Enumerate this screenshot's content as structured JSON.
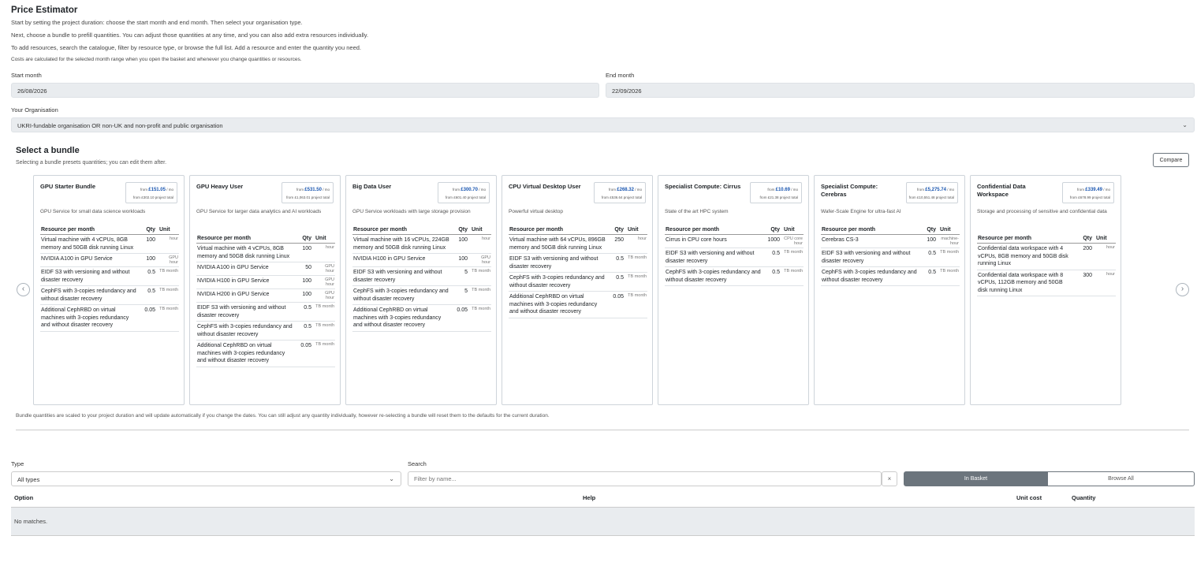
{
  "page": {
    "title": "Price Estimator",
    "intro": [
      "Start by setting the project duration: choose the start month and end month. Then select your organisation type.",
      "Next, choose a bundle to prefill quantities. You can adjust those quantities at any time, and you can also add extra resources individually.",
      "To add resources, search the catalogue, filter by resource type, or browse the full list. Add a resource and enter the quantity you need.",
      "Costs are calculated for the selected month range when you open the basket and whenever you change quantities or resources."
    ]
  },
  "dates": {
    "start_label": "Start month",
    "start_value": "26/08/2026",
    "end_label": "End month",
    "end_value": "22/09/2026"
  },
  "org": {
    "label": "Your Organisation",
    "value": "UKRI-fundable organisation OR non-UK and non-profit and public organisation"
  },
  "bundles": {
    "title": "Select a bundle",
    "subtitle": "Selecting a bundle presets quantities; you can edit them after.",
    "compare_label": "Compare",
    "prev_icon": "chevron-left-icon",
    "next_icon": "chevron-right-icon",
    "note": "Bundle quantities are scaled to your project duration and will update automatically if you change the dates. You can still adjust any quantity individually, however re-selecting a bundle will reset them to the defaults for the current duration.",
    "headers": {
      "resource": "Resource per month",
      "qty": "Qty",
      "unit": "Unit"
    },
    "price_from": "from",
    "per_month": "/ mo",
    "project_total": "project total",
    "cards": [
      {
        "name": "GPU Starter Bundle",
        "monthly": "£151.05",
        "total": "£302.10",
        "desc": "GPU Service for small data science workloads",
        "rows": [
          {
            "r": "Virtual machine with 4 vCPUs, 8GB memory and 50GB disk running Linux",
            "q": "100",
            "u": "hour"
          },
          {
            "r": "NVIDIA A100 in GPU Service",
            "q": "100",
            "u": "GPU hour"
          },
          {
            "r": "EIDF S3 with versioning and without disaster recovery",
            "q": "0.5",
            "u": "TB month"
          },
          {
            "r": "CephFS with 3-copies redundancy and without disaster recovery",
            "q": "0.5",
            "u": "TB month"
          },
          {
            "r": "Additional CephRBD on virtual machines with 3-copies redundancy and without disaster recovery",
            "q": "0.05",
            "u": "TB month"
          }
        ]
      },
      {
        "name": "GPU Heavy User",
        "monthly": "£531.50",
        "total": "£1,063.01",
        "desc": "GPU Service for larger data analytics and AI workloads",
        "rows": [
          {
            "r": "Virtual machine with 4 vCPUs, 8GB memory and 50GB disk running Linux",
            "q": "100",
            "u": "hour"
          },
          {
            "r": "NVIDIA A100 in GPU Service",
            "q": "50",
            "u": "GPU hour"
          },
          {
            "r": "NVIDIA H100 in GPU Service",
            "q": "100",
            "u": "GPU hour"
          },
          {
            "r": "NVIDIA H200 in GPU Service",
            "q": "100",
            "u": "GPU hour"
          },
          {
            "r": "EIDF S3 with versioning and without disaster recovery",
            "q": "0.5",
            "u": "TB month"
          },
          {
            "r": "CephFS with 3-copies redundancy and without disaster recovery",
            "q": "0.5",
            "u": "TB month"
          },
          {
            "r": "Additional CephRBD on virtual machines with 3-copies redundancy and without disaster recovery",
            "q": "0.05",
            "u": "TB month"
          }
        ]
      },
      {
        "name": "Big Data User",
        "monthly": "£300.70",
        "total": "£601.40",
        "desc": "GPU Service workloads with large storage provision",
        "rows": [
          {
            "r": "Virtual machine with 16 vCPUs, 224GB memory and 50GB disk running Linux",
            "q": "100",
            "u": "hour"
          },
          {
            "r": "NVIDIA H100 in GPU Service",
            "q": "100",
            "u": "GPU hour"
          },
          {
            "r": "EIDF S3 with versioning and without disaster recovery",
            "q": "5",
            "u": "TB month"
          },
          {
            "r": "CephFS with 3-copies redundancy and without disaster recovery",
            "q": "5",
            "u": "TB month"
          },
          {
            "r": "Additional CephRBD on virtual machines with 3-copies redundancy and without disaster recovery",
            "q": "0.05",
            "u": "TB month"
          }
        ]
      },
      {
        "name": "CPU Virtual Desktop User",
        "monthly": "£268.32",
        "total": "£536.64",
        "desc": "Powerful virtual desktop",
        "rows": [
          {
            "r": "Virtual machine with 64 vCPUs, 896GB memory and 50GB disk running Linux",
            "q": "250",
            "u": "hour"
          },
          {
            "r": "EIDF S3 with versioning and without disaster recovery",
            "q": "0.5",
            "u": "TB month"
          },
          {
            "r": "CephFS with 3-copies redundancy and without disaster recovery",
            "q": "0.5",
            "u": "TB month"
          },
          {
            "r": "Additional CephRBD on virtual machines with 3-copies redundancy and without disaster recovery",
            "q": "0.05",
            "u": "TB month"
          }
        ]
      },
      {
        "name": "Specialist Compute: Cirrus",
        "monthly": "£10.69",
        "total": "£21.38",
        "desc": "State of the art HPC system",
        "rows": [
          {
            "r": "Cirrus in CPU core hours",
            "q": "1000",
            "u": "CPU core hour"
          },
          {
            "r": "EIDF S3 with versioning and without disaster recovery",
            "q": "0.5",
            "u": "TB month"
          },
          {
            "r": "CephFS with 3-copies redundancy and without disaster recovery",
            "q": "0.5",
            "u": "TB month"
          }
        ]
      },
      {
        "name": "Specialist Compute: Cerebras",
        "monthly": "£5,275.74",
        "total": "£10,551.48",
        "desc": "Wafer-Scale Engine for ultra-fast AI",
        "rows": [
          {
            "r": "Cerebras CS-3",
            "q": "100",
            "u": "machine-hour"
          },
          {
            "r": "EIDF S3 with versioning and without disaster recovery",
            "q": "0.5",
            "u": "TB month"
          },
          {
            "r": "CephFS with 3-copies redundancy and without disaster recovery",
            "q": "0.5",
            "u": "TB month"
          }
        ]
      },
      {
        "name": "Confidential Data Workspace",
        "monthly": "£339.49",
        "total": "£678.99",
        "desc": "Storage and processing of sensitive and confidential data",
        "rows": [
          {
            "r": "Confidential data workspace with 4 vCPUs, 8GB memory and 50GB disk running Linux",
            "q": "200",
            "u": "hour"
          },
          {
            "r": "Confidential data workspace with 8 vCPUs, 112GB memory and 50GB disk running Linux",
            "q": "300",
            "u": "hour"
          }
        ]
      }
    ]
  },
  "filters": {
    "type_label": "Type",
    "type_value": "All types",
    "search_label": "Search",
    "search_placeholder": "Filter by name...",
    "clear_label": "×",
    "toggle_in_basket": "In Basket",
    "toggle_browse_all": "Browse All"
  },
  "results": {
    "col_option": "Option",
    "col_help": "Help",
    "col_unit_cost": "Unit cost",
    "col_quantity": "Quantity",
    "empty": "No matches."
  },
  "colors": {
    "active_toggle": "#6c757d",
    "price_accent": "#1a56b0",
    "field_bg": "#e9ecef"
  }
}
